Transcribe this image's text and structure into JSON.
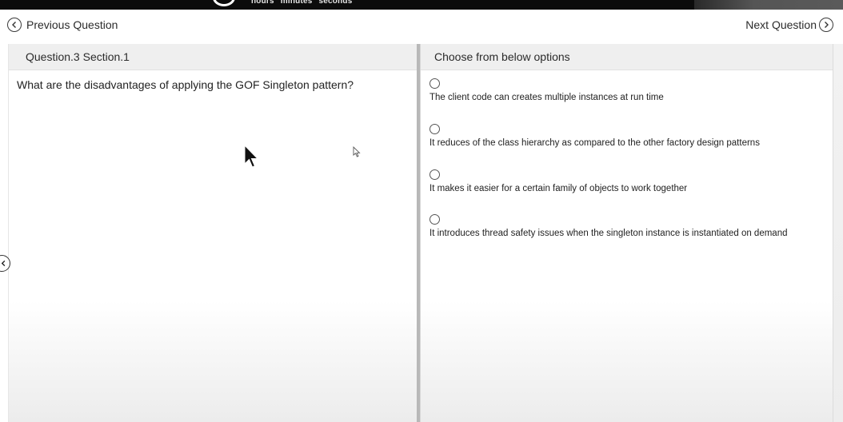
{
  "timer": {
    "labels": [
      "hours",
      "minutes",
      "seconds"
    ]
  },
  "nav": {
    "previous_label": "Previous Question",
    "next_label": "Next Question"
  },
  "question_panel": {
    "header": "Question.3 Section.1",
    "question": "What are the disadvantages of applying the GOF Singleton pattern?"
  },
  "options_panel": {
    "header": "Choose from below options",
    "options": [
      {
        "label": "The client code can creates multiple instances at run time",
        "selected": false
      },
      {
        "label": "It reduces of the class hierarchy as compared to the other factory design patterns",
        "selected": false
      },
      {
        "label": "It makes it easier for a certain family of objects to work together",
        "selected": false
      },
      {
        "label": "It introduces thread safety issues when the singleton instance is instantiated on demand",
        "selected": false
      }
    ]
  },
  "colors": {
    "topbar": "#0c0c0c",
    "header_bg": "#efefef",
    "divider": "#b8b8b8",
    "text": "#222222"
  },
  "icons": {
    "previous": "chevron-left-circle-icon",
    "next": "chevron-right-circle-icon",
    "timer": "clock-icon",
    "side_collapse": "chevron-left-circle-icon",
    "cursor": "mouse-pointer-icon"
  }
}
